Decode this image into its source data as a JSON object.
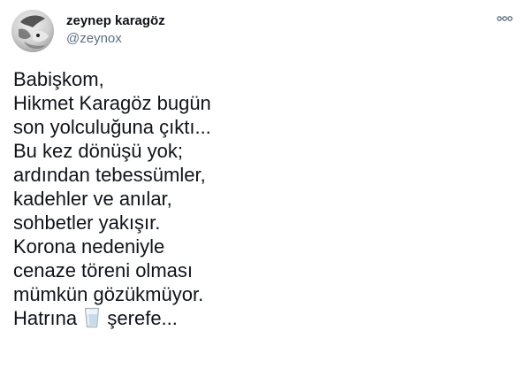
{
  "tweet": {
    "author": {
      "display_name": "zeynep karagöz",
      "handle": "@zeynox"
    },
    "more_icon": "ellipsis-icon",
    "body": {
      "lines": [
        "Babişkom,",
        "Hikmet Karagöz bugün",
        "son yolculuğuna çıktı...",
        "Bu kez dönüşü yok;",
        "ardından tebessümler,",
        "kadehler ve anılar,",
        "sohbetler yakışır.",
        "Korona nedeniyle",
        "cenaze töreni olması",
        "mümkün gözükmüyor."
      ],
      "last_line_before_emoji": "Hatrına",
      "emoji": "glass-of-water-emoji",
      "last_line_after_emoji": "şerefe..."
    }
  },
  "colors": {
    "text": "#0f1419",
    "secondary_text": "#5b7083"
  }
}
